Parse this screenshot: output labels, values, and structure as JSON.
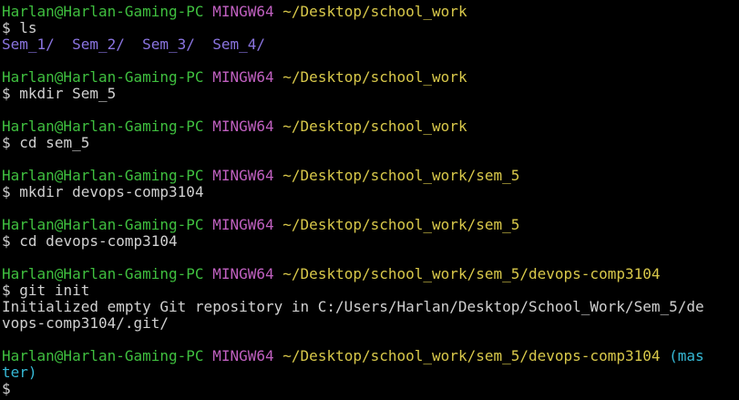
{
  "prompt": {
    "user": "Harlan@Harlan-Gaming-PC",
    "shell": "MINGW64",
    "dollar": "$"
  },
  "entries": [
    {
      "path": "~/Desktop/school_work",
      "command": "ls",
      "dirs": [
        "Sem_1/",
        "Sem_2/",
        "Sem_3/",
        "Sem_4/"
      ]
    },
    {
      "path": "~/Desktop/school_work",
      "command": "mkdir Sem_5"
    },
    {
      "path": "~/Desktop/school_work",
      "command": "cd sem_5"
    },
    {
      "path": "~/Desktop/school_work/sem_5",
      "command": "mkdir devops-comp3104"
    },
    {
      "path": "~/Desktop/school_work/sem_5",
      "command": "cd devops-comp3104"
    },
    {
      "path": "~/Desktop/school_work/sem_5/devops-comp3104",
      "command": "git init",
      "output": [
        "Initialized empty Git repository in C:/Users/Harlan/Desktop/School_Work/Sem_5/de",
        "vops-comp3104/.git/"
      ]
    },
    {
      "path": "~/Desktop/school_work/sem_5/devops-comp3104",
      "branch_part1": "(mas",
      "branch_part2": "ter)"
    }
  ],
  "colors": {
    "background": "#000000",
    "user": "#3fbf3f",
    "shell": "#c060c0",
    "path": "#d8c84a",
    "branch": "#36b9d6",
    "dir": "#8a74e0",
    "text": "#d0d0d0"
  }
}
